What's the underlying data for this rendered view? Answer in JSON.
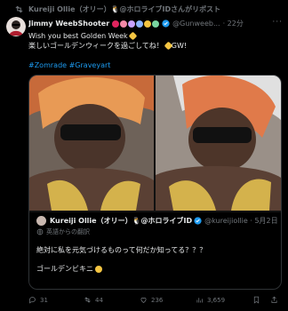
{
  "repost": {
    "text": "Kureiji Ollie（オリー）🐧@ホロライブIDさんがリポスト"
  },
  "tweet": {
    "display_name": "Jimmy WeebShooter",
    "handle": "@Gunweeb...",
    "time": "· 22分",
    "line1": "Wish you best Golden Week",
    "line2": "楽しいゴールデンウィークを過ごしてね！",
    "line2_tail": "GW!",
    "hashtags": "#Zomrade #Graveyart"
  },
  "quote": {
    "display_name": "Kureiji Ollie（オリー）🐧@ホロライブID",
    "handle": "@kureijiollie · 5月2日",
    "translate_label": "英語からの翻訳",
    "line1": "絶対に私を元気づけるものって何だか知ってる？？？",
    "line2": "ゴールデンビキニ"
  },
  "actions": {
    "replies": "31",
    "reposts": "44",
    "likes": "236",
    "views": "3,659"
  },
  "colors": {
    "accent": "#1d9bf0",
    "muted": "#71767b",
    "text": "#e7e9ea",
    "bg": "#000000"
  }
}
